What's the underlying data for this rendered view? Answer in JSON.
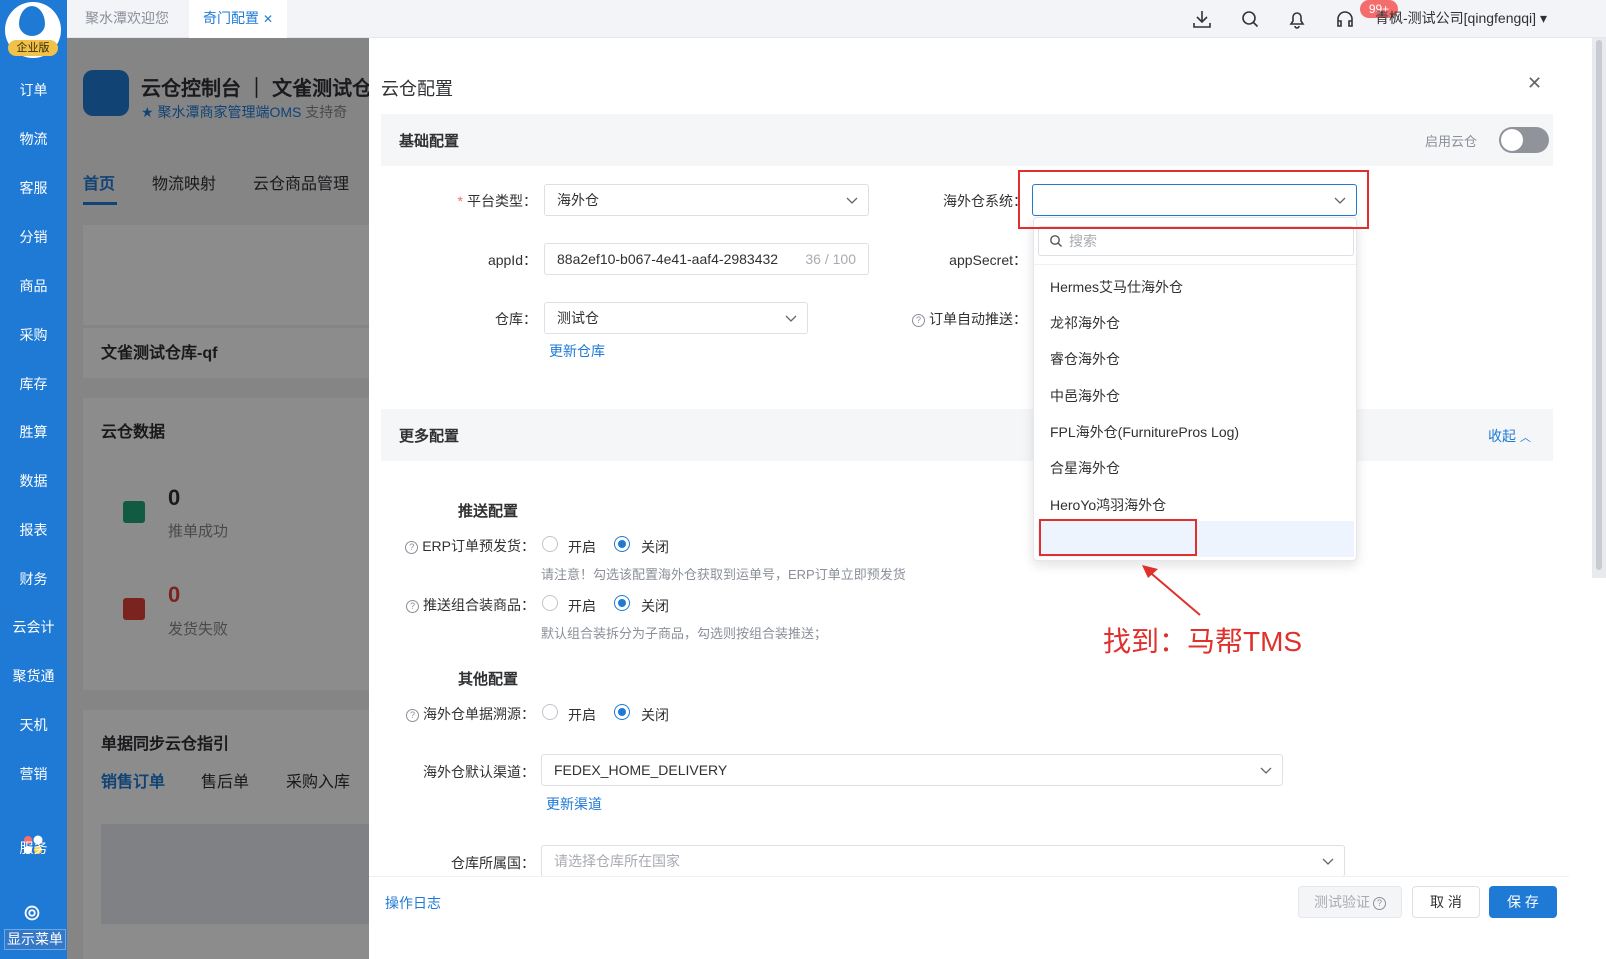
{
  "sidebar": {
    "brand_tag": "企业版",
    "items": [
      "订单",
      "物流",
      "客服",
      "分销",
      "商品",
      "采购",
      "库存",
      "胜算",
      "数据",
      "报表",
      "财务",
      "云会计",
      "聚货通",
      "天机",
      "营销",
      "服务"
    ],
    "show_menu": "显示菜单"
  },
  "topbar": {
    "tabs": [
      "聚水潭欢迎您",
      "奇门配置"
    ],
    "notification_badge": "99+",
    "user": "青枫-测试公司[qingfengqi]"
  },
  "background": {
    "console_title": "云仓控制台 ｜ 文雀测试仓",
    "console_sub": "聚水潭商家管理端OMS",
    "console_sub2": "支持奇",
    "tabs": [
      "首页",
      "物流映射",
      "云仓商品管理"
    ],
    "warehouse_name": "文雀测试仓库-qf",
    "cloud_data": "云仓数据",
    "push_success_count": "0",
    "push_success_label": "推单成功",
    "ship_fail_count": "0",
    "ship_fail_label": "发货失败",
    "guide_title": "单据同步云仓指引",
    "guide_tabs": [
      "销售订单",
      "售后单",
      "采购入库"
    ]
  },
  "drawer": {
    "title": "云仓配置",
    "basic_section": "基础配置",
    "enable_label": "启用云仓",
    "platform_type_label": "平台类型：",
    "platform_type_value": "海外仓",
    "overseas_system_label": "海外仓系统：",
    "appid_label": "appId：",
    "appid_value": "88a2ef10-b067-4e41-aaf4-2983432",
    "appid_count": "36 / 100",
    "appsecret_label": "appSecret：",
    "warehouse_label": "仓库：",
    "warehouse_value": "测试仓",
    "auto_push_label": "订单自动推送：",
    "update_warehouse": "更新仓库",
    "more_section": "更多配置",
    "collapse": "收起",
    "push_config": "推送配置",
    "erp_presend_label": "ERP订单预发货：",
    "open": "开启",
    "close": "关闭",
    "erp_presend_hint": "请注意！勾选该配置海外仓获取到运单号，ERP订单立即预发货",
    "push_combo_label": "推送组合装商品：",
    "push_combo_hint": "默认组合装拆分为子商品，勾选则按组合装推送；",
    "other_config": "其他配置",
    "trace_label": "海外仓单据溯源：",
    "default_channel_label": "海外仓默认渠道：",
    "default_channel_value": "FEDEX_HOME_DELIVERY",
    "update_channel": "更新渠道",
    "country_label": "仓库所属国：",
    "country_placeholder": "请选择仓库所在国家",
    "op_log": "操作日志",
    "test_btn": "测试验证",
    "cancel_btn": "取 消",
    "save_btn": "保 存"
  },
  "dropdown": {
    "search_placeholder": "搜索",
    "options": [
      "Hermes艾马仕海外仓",
      "龙祁海外仓",
      "睿仓海外仓",
      "中邑海外仓",
      "FPL海外仓(FurniturePros Log)",
      "合星海外仓",
      "HeroYo鸿羽海外仓"
    ]
  },
  "annotation": "找到：马帮TMS",
  "colors": {
    "primary": "#1f7ad6",
    "annotation": "#e0302b",
    "danger": "#f56c6c"
  }
}
